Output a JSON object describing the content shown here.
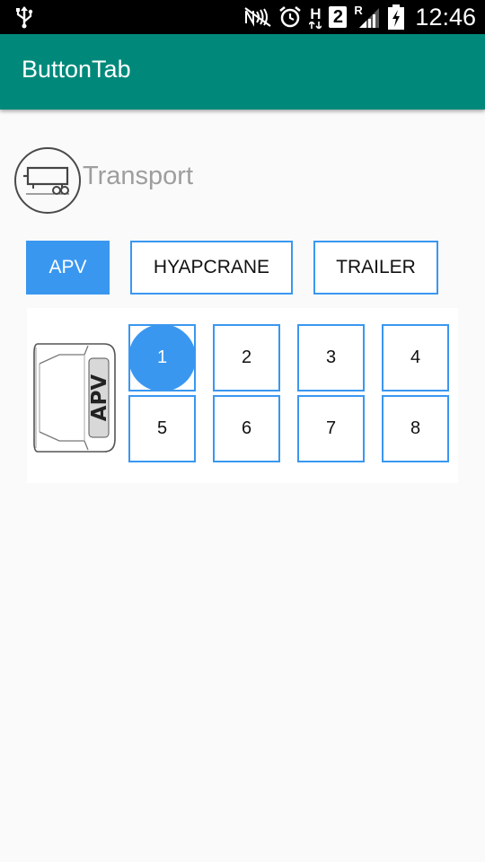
{
  "status_bar": {
    "time": "12:46",
    "icons": [
      "usb-icon",
      "nfc-icon",
      "alarm-icon",
      "hspa-icon",
      "sim2-icon",
      "roaming-signal-icon",
      "battery-charging-icon"
    ],
    "network_letter": "H",
    "sim_label": "2",
    "roaming_letter": "R"
  },
  "app_bar": {
    "title": "ButtonTab"
  },
  "header": {
    "label": "Transport",
    "icon": "trailer-icon"
  },
  "tabs": [
    {
      "label": "APV",
      "active": true
    },
    {
      "label": "HYAPCRANE",
      "active": false
    },
    {
      "label": "TRAILER",
      "active": false
    }
  ],
  "vehicle": {
    "label": "APV",
    "icon": "apv-vehicle-icon"
  },
  "seats": [
    {
      "label": "1",
      "selected": true
    },
    {
      "label": "2",
      "selected": false
    },
    {
      "label": "3",
      "selected": false
    },
    {
      "label": "4",
      "selected": false
    },
    {
      "label": "5",
      "selected": false
    },
    {
      "label": "6",
      "selected": false
    },
    {
      "label": "7",
      "selected": false
    },
    {
      "label": "8",
      "selected": false
    }
  ],
  "colors": {
    "accent": "#3a97f0",
    "app_bar": "#00897b",
    "status_bar": "#000000"
  }
}
